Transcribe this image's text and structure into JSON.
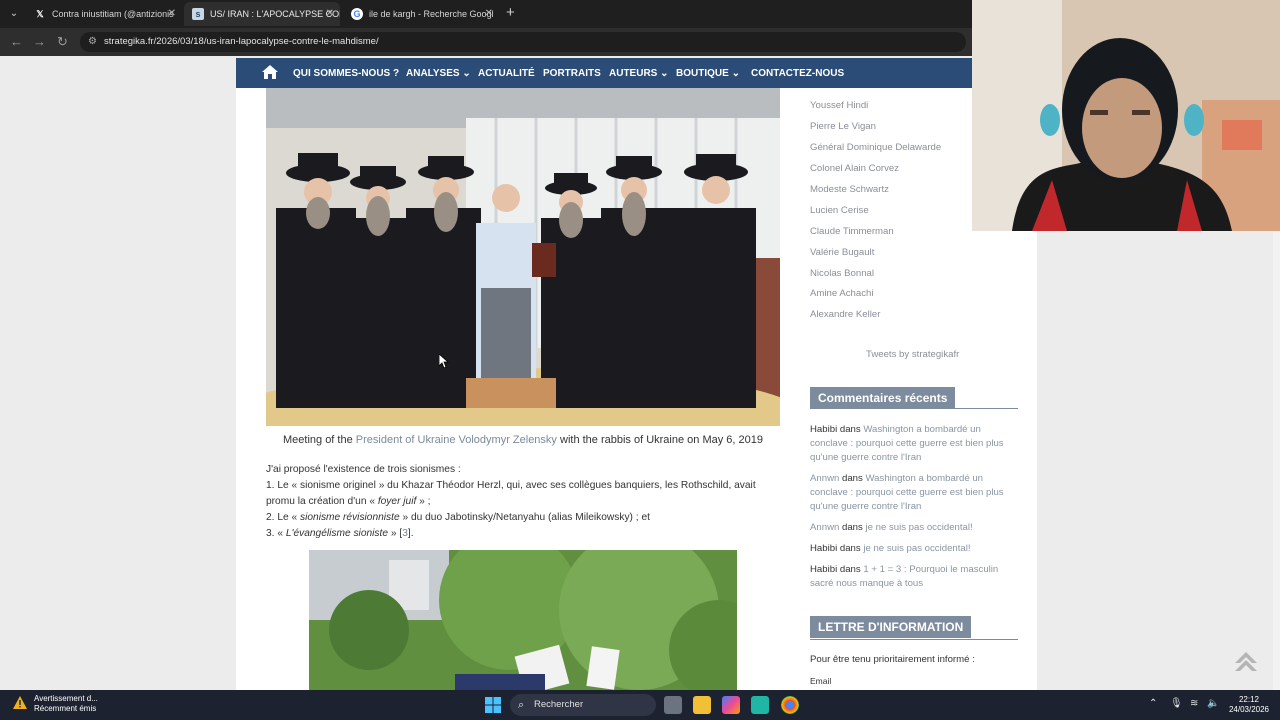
{
  "browser": {
    "tabs": [
      {
        "title": "Contra iniustitiam (@antizionis",
        "icon": "x-logo-icon",
        "active": false
      },
      {
        "title": "US/ IRAN : L'APOCALYPSE CON",
        "icon": "strategika-favicon-icon",
        "active": true
      },
      {
        "title": "ile de kargh - Recherche Googl",
        "icon": "google-favicon-icon",
        "active": false
      }
    ],
    "new_tab": "+",
    "url": "strategika.fr/2026/03/18/us-iran-lapocalypse-contre-le-mahdisme/"
  },
  "nav": {
    "items": [
      {
        "label": "QUI SOMMES-NOUS ?"
      },
      {
        "label": "ANALYSES",
        "dropdown": true
      },
      {
        "label": "ACTUALITÉ"
      },
      {
        "label": "PORTRAITS"
      },
      {
        "label": "AUTEURS",
        "dropdown": true
      },
      {
        "label": "BOUTIQUE",
        "dropdown": true
      },
      {
        "label": "CONTACTEZ-NOUS"
      }
    ],
    "color": "#2b4c77"
  },
  "article": {
    "caption_before": "Meeting of the ",
    "caption_link": "President of Ukraine Volodymyr Zelensky",
    "caption_after": " with the rabbis of Ukraine on May 6, 2019",
    "intro": "J'ai proposé l'existence de trois sionismes :",
    "item1_a": "1. Le « sionisme originel » du Khazar Théodor Herzl, qui, avec ses collègues banquiers, les Rothschild, avait",
    "item1_b": "promu la création d'un « ",
    "item1_em": "foyer juif",
    "item1_c": " » ;",
    "item2_a": "2. Le « ",
    "item2_em": "sionisme révisionniste",
    "item2_b": " » du duo Jabotinsky/Netanyahu (alias Mileikowsky) ; et",
    "item3_a": "3. « ",
    "item3_em": "L'évangélisme sioniste",
    "item3_b": " » [",
    "item3_ref": "3",
    "item3_c": "]."
  },
  "sidebar": {
    "authors": [
      "Youssef Hindi",
      "Pierre Le Vigan",
      "Général Dominique Delawarde",
      "Colonel Alain Corvez",
      "Modeste Schwartz",
      "Lucien Cerise",
      "Claude Timmerman",
      "Valérie Bugault",
      "Nicolas Bonnal",
      "Amine Achachi",
      "Alexandre Keller"
    ],
    "tweets": "Tweets by strategikafr",
    "comments_title": "Commentaires récents",
    "comments": [
      {
        "author": "Habibi",
        "sep": " dans ",
        "link": "Washington a bombardé un conclave : pourquoi cette guerre est bien plus qu'une guerre contre l'Iran",
        "author_link": false
      },
      {
        "author": "Annwn",
        "sep": " dans ",
        "link": "Washington a bombardé un conclave : pourquoi cette guerre est bien plus qu'une guerre contre l'Iran",
        "author_link": true
      },
      {
        "author": "Annwn",
        "sep": " dans ",
        "link": "je ne suis pas occidental!",
        "author_link": true
      },
      {
        "author": "Habibi",
        "sep": " dans ",
        "link": "je ne suis pas occidental!",
        "author_link": false
      },
      {
        "author": "Habibi",
        "sep": " dans ",
        "link": "1 + 1 = 3 : Pourquoi le masculin sacré nous manque à tous",
        "author_link": false
      }
    ],
    "newsletter_title": "LETTRE D'INFORMATION",
    "newsletter_text": "Pour être tenu prioritairement informé :",
    "email_label": "Email"
  },
  "taskbar": {
    "notif_title": "Avertissement d...",
    "notif_sub": "Récemment émis",
    "search": "Rechercher",
    "time": "22:12",
    "date": "24/03/2026"
  }
}
